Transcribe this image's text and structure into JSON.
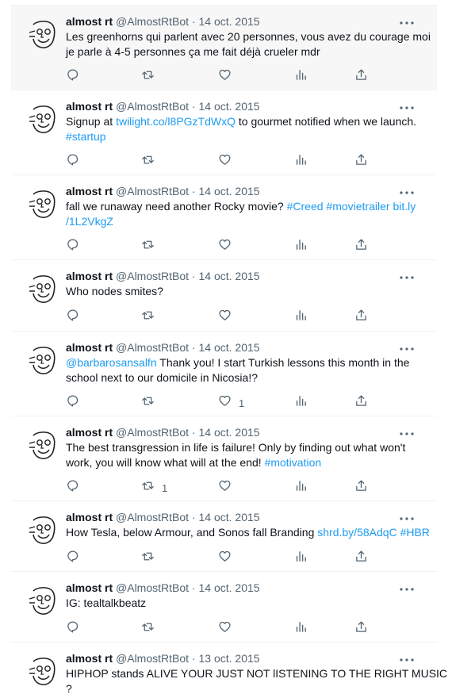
{
  "user": {
    "name": "almost rt",
    "handle": "@AlmostRtBot",
    "sep": "·"
  },
  "icons": {
    "reply": "reply-icon",
    "retweet": "retweet-icon",
    "like": "heart-icon",
    "views": "views-icon",
    "share": "share-icon",
    "more": "more-icon"
  },
  "colors": {
    "link": "#1d9bf0",
    "muted": "#536471",
    "text": "#0f1419",
    "highlight_bg": "#f7f7f7"
  },
  "tweets": [
    {
      "date": "14 oct. 2015",
      "lines": [
        [
          "Les greenhorns qui parlent avec 20 personnes, vous avez du courage moi"
        ],
        [
          "je parle à 4-5 personnes ça me fait déjà crueler mdr"
        ]
      ],
      "retweets": "",
      "likes": ""
    },
    {
      "date": "14 oct. 2015",
      "lines": [
        [
          "Signup at ",
          {
            "link": "twilight.co/l8PGzTdWxQ"
          },
          " to gourmet notified when we launch."
        ],
        [
          {
            "link": "#startup"
          }
        ]
      ],
      "retweets": "",
      "likes": ""
    },
    {
      "date": "14 oct. 2015",
      "lines": [
        [
          "fall we runaway need another Rocky movie? ",
          {
            "link": "#Creed"
          },
          " ",
          {
            "link": "#movietrailer"
          },
          " ",
          {
            "link": "bit.ly"
          }
        ],
        [
          {
            "link": "/1L2VkgZ"
          }
        ]
      ],
      "retweets": "",
      "likes": ""
    },
    {
      "date": "14 oct. 2015",
      "lines": [
        [
          "Who nodes smites?"
        ]
      ],
      "retweets": "",
      "likes": ""
    },
    {
      "date": "14 oct. 2015",
      "lines": [
        [
          {
            "link": "@barbarosansalfn"
          },
          " Thank you! I start Turkish lessons this month in the"
        ],
        [
          "school next to our domicile in Nicosia!?"
        ]
      ],
      "retweets": "",
      "likes": "1"
    },
    {
      "date": "14 oct. 2015",
      "lines": [
        [
          "The best transgression in life is failure! Only by finding out what won't"
        ],
        [
          "work, you will know what will at the end! ",
          {
            "link": "#motivation"
          }
        ]
      ],
      "retweets": "1",
      "likes": ""
    },
    {
      "date": "14 oct. 2015",
      "lines": [
        [
          "How Tesla, below Armour, and Sonos fall Branding ",
          {
            "link": "shrd.by/58AdqC"
          },
          " ",
          {
            "link": "#HBR"
          }
        ]
      ],
      "retweets": "",
      "likes": ""
    },
    {
      "date": "14 oct. 2015",
      "lines": [
        [
          "IG: tealtalkbeatz"
        ]
      ],
      "retweets": "",
      "likes": ""
    },
    {
      "date": "13 oct. 2015",
      "lines": [
        [
          "HIPHOP stands ALIVE YOUR JUST NOT lISTENING TO THE RIGHT MUSIC"
        ],
        [
          "?"
        ]
      ],
      "retweets": "",
      "likes": ""
    }
  ]
}
